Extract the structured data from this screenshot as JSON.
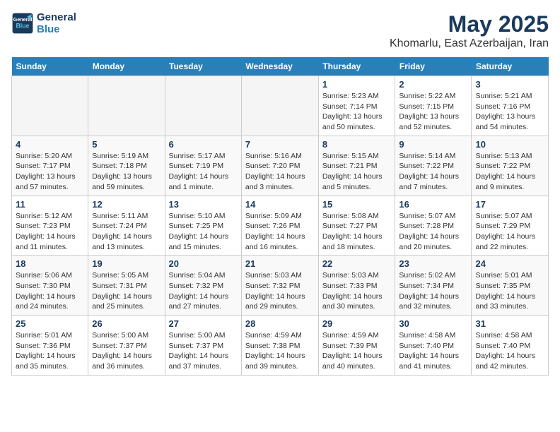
{
  "header": {
    "logo_line1": "General",
    "logo_line2": "Blue",
    "month": "May 2025",
    "location": "Khomarlu, East Azerbaijan, Iran"
  },
  "weekdays": [
    "Sunday",
    "Monday",
    "Tuesday",
    "Wednesday",
    "Thursday",
    "Friday",
    "Saturday"
  ],
  "weeks": [
    [
      {
        "day": "",
        "info": ""
      },
      {
        "day": "",
        "info": ""
      },
      {
        "day": "",
        "info": ""
      },
      {
        "day": "",
        "info": ""
      },
      {
        "day": "1",
        "info": "Sunrise: 5:23 AM\nSunset: 7:14 PM\nDaylight: 13 hours\nand 50 minutes."
      },
      {
        "day": "2",
        "info": "Sunrise: 5:22 AM\nSunset: 7:15 PM\nDaylight: 13 hours\nand 52 minutes."
      },
      {
        "day": "3",
        "info": "Sunrise: 5:21 AM\nSunset: 7:16 PM\nDaylight: 13 hours\nand 54 minutes."
      }
    ],
    [
      {
        "day": "4",
        "info": "Sunrise: 5:20 AM\nSunset: 7:17 PM\nDaylight: 13 hours\nand 57 minutes."
      },
      {
        "day": "5",
        "info": "Sunrise: 5:19 AM\nSunset: 7:18 PM\nDaylight: 13 hours\nand 59 minutes."
      },
      {
        "day": "6",
        "info": "Sunrise: 5:17 AM\nSunset: 7:19 PM\nDaylight: 14 hours\nand 1 minute."
      },
      {
        "day": "7",
        "info": "Sunrise: 5:16 AM\nSunset: 7:20 PM\nDaylight: 14 hours\nand 3 minutes."
      },
      {
        "day": "8",
        "info": "Sunrise: 5:15 AM\nSunset: 7:21 PM\nDaylight: 14 hours\nand 5 minutes."
      },
      {
        "day": "9",
        "info": "Sunrise: 5:14 AM\nSunset: 7:22 PM\nDaylight: 14 hours\nand 7 minutes."
      },
      {
        "day": "10",
        "info": "Sunrise: 5:13 AM\nSunset: 7:22 PM\nDaylight: 14 hours\nand 9 minutes."
      }
    ],
    [
      {
        "day": "11",
        "info": "Sunrise: 5:12 AM\nSunset: 7:23 PM\nDaylight: 14 hours\nand 11 minutes."
      },
      {
        "day": "12",
        "info": "Sunrise: 5:11 AM\nSunset: 7:24 PM\nDaylight: 14 hours\nand 13 minutes."
      },
      {
        "day": "13",
        "info": "Sunrise: 5:10 AM\nSunset: 7:25 PM\nDaylight: 14 hours\nand 15 minutes."
      },
      {
        "day": "14",
        "info": "Sunrise: 5:09 AM\nSunset: 7:26 PM\nDaylight: 14 hours\nand 16 minutes."
      },
      {
        "day": "15",
        "info": "Sunrise: 5:08 AM\nSunset: 7:27 PM\nDaylight: 14 hours\nand 18 minutes."
      },
      {
        "day": "16",
        "info": "Sunrise: 5:07 AM\nSunset: 7:28 PM\nDaylight: 14 hours\nand 20 minutes."
      },
      {
        "day": "17",
        "info": "Sunrise: 5:07 AM\nSunset: 7:29 PM\nDaylight: 14 hours\nand 22 minutes."
      }
    ],
    [
      {
        "day": "18",
        "info": "Sunrise: 5:06 AM\nSunset: 7:30 PM\nDaylight: 14 hours\nand 24 minutes."
      },
      {
        "day": "19",
        "info": "Sunrise: 5:05 AM\nSunset: 7:31 PM\nDaylight: 14 hours\nand 25 minutes."
      },
      {
        "day": "20",
        "info": "Sunrise: 5:04 AM\nSunset: 7:32 PM\nDaylight: 14 hours\nand 27 minutes."
      },
      {
        "day": "21",
        "info": "Sunrise: 5:03 AM\nSunset: 7:32 PM\nDaylight: 14 hours\nand 29 minutes."
      },
      {
        "day": "22",
        "info": "Sunrise: 5:03 AM\nSunset: 7:33 PM\nDaylight: 14 hours\nand 30 minutes."
      },
      {
        "day": "23",
        "info": "Sunrise: 5:02 AM\nSunset: 7:34 PM\nDaylight: 14 hours\nand 32 minutes."
      },
      {
        "day": "24",
        "info": "Sunrise: 5:01 AM\nSunset: 7:35 PM\nDaylight: 14 hours\nand 33 minutes."
      }
    ],
    [
      {
        "day": "25",
        "info": "Sunrise: 5:01 AM\nSunset: 7:36 PM\nDaylight: 14 hours\nand 35 minutes."
      },
      {
        "day": "26",
        "info": "Sunrise: 5:00 AM\nSunset: 7:37 PM\nDaylight: 14 hours\nand 36 minutes."
      },
      {
        "day": "27",
        "info": "Sunrise: 5:00 AM\nSunset: 7:37 PM\nDaylight: 14 hours\nand 37 minutes."
      },
      {
        "day": "28",
        "info": "Sunrise: 4:59 AM\nSunset: 7:38 PM\nDaylight: 14 hours\nand 39 minutes."
      },
      {
        "day": "29",
        "info": "Sunrise: 4:59 AM\nSunset: 7:39 PM\nDaylight: 14 hours\nand 40 minutes."
      },
      {
        "day": "30",
        "info": "Sunrise: 4:58 AM\nSunset: 7:40 PM\nDaylight: 14 hours\nand 41 minutes."
      },
      {
        "day": "31",
        "info": "Sunrise: 4:58 AM\nSunset: 7:40 PM\nDaylight: 14 hours\nand 42 minutes."
      }
    ]
  ]
}
